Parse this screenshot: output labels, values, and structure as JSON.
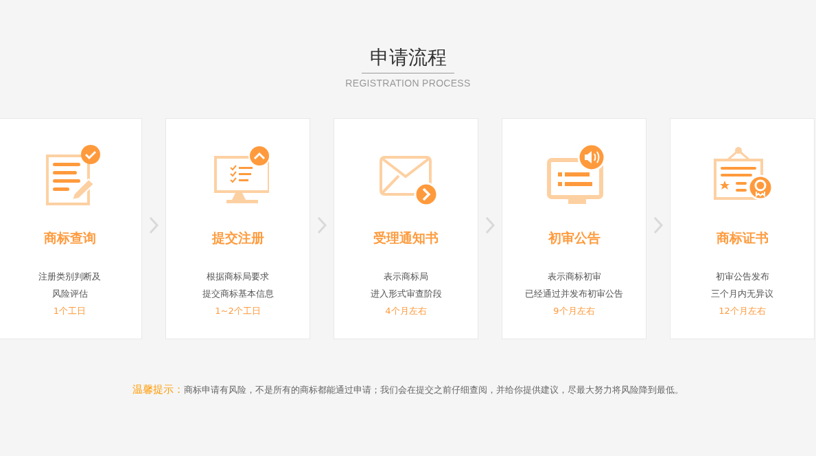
{
  "header": {
    "title": "申请流程",
    "subtitle": "REGISTRATION PROCESS"
  },
  "steps": [
    {
      "kind": "document",
      "title": "商标查询",
      "lines": [
        "注册类别判断及",
        "风险评估"
      ],
      "duration": "1个工日"
    },
    {
      "kind": "checklist",
      "title": "提交注册",
      "lines": [
        "根据商标局要求",
        "提交商标基本信息"
      ],
      "duration": "1~2个工日"
    },
    {
      "kind": "envelope",
      "title": "受理通知书",
      "lines": [
        "表示商标局",
        "进入形式审查阶段"
      ],
      "duration": "4个月左右"
    },
    {
      "kind": "announcement",
      "title": "初审公告",
      "lines": [
        "表示商标初审",
        "已经通过并发布初审公告"
      ],
      "duration": "9个月左右"
    },
    {
      "kind": "certificate",
      "title": "商标证书",
      "lines": [
        "初审公告发布",
        "三个月内无异议"
      ],
      "duration": "12个月左右"
    }
  ],
  "notice": {
    "label": "温馨提示：",
    "text": "商标申请有风险，不是所有的商标都能通过申请；我们会在提交之前仔细查阅，并给你提供建议，尽最大努力将风险降到最低。"
  }
}
